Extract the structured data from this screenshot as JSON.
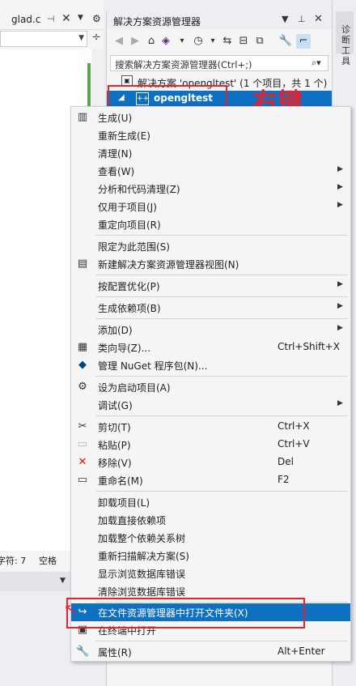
{
  "editor": {
    "tab_label": "glad.c",
    "tab_pin_icon": "pin-icon",
    "tab_close_icon": "close-icon",
    "status_chars": "字符: 7",
    "status_spaces": "空格"
  },
  "solution_explorer": {
    "title": "解决方案资源管理器",
    "search_placeholder": "搜索解决方案资源管理器(Ctrl+;)",
    "solution_label": "解决方案 'opengltest' (1 个项目，共 1 个)",
    "project_label": "opengltest"
  },
  "right_rail": {
    "label": "诊断工具"
  },
  "annotation": {
    "right_click_label": "右键",
    "color": "#e8222b"
  },
  "context_menu": {
    "items": [
      {
        "label": "生成(U)",
        "icon": "build-icon"
      },
      {
        "label": "重新生成(E)"
      },
      {
        "label": "清理(N)"
      },
      {
        "label": "查看(W)",
        "submenu": true
      },
      {
        "label": "分析和代码清理(Z)",
        "submenu": true
      },
      {
        "label": "仅用于项目(J)",
        "submenu": true
      },
      {
        "label": "重定向项目(R)"
      },
      {
        "label": "限定为此范围(S)"
      },
      {
        "label": "新建解决方案资源管理器视图(N)",
        "icon": "new-view-icon"
      },
      {
        "label": "按配置优化(P)",
        "submenu": true
      },
      {
        "label": "生成依赖项(B)",
        "submenu": true
      },
      {
        "label": "添加(D)",
        "submenu": true
      },
      {
        "label": "类向导(Z)...",
        "shortcut": "Ctrl+Shift+X",
        "icon": "class-wizard-icon"
      },
      {
        "label": "管理 NuGet 程序包(N)...",
        "icon": "nuget-icon"
      },
      {
        "label": "设为启动项目(A)",
        "icon": "gear-icon"
      },
      {
        "label": "调试(G)",
        "submenu": true
      },
      {
        "label": "剪切(T)",
        "shortcut": "Ctrl+X",
        "icon": "scissors-icon"
      },
      {
        "label": "粘贴(P)",
        "shortcut": "Ctrl+V",
        "icon": "paste-icon"
      },
      {
        "label": "移除(V)",
        "shortcut": "Del",
        "icon": "remove-icon"
      },
      {
        "label": "重命名(M)",
        "shortcut": "F2",
        "icon": "rename-icon"
      },
      {
        "label": "卸载项目(L)"
      },
      {
        "label": "加载直接依赖项"
      },
      {
        "label": "加载整个依赖关系树"
      },
      {
        "label": "重新扫描解决方案(S)"
      },
      {
        "label": "显示浏览数据库错误"
      },
      {
        "label": "清除浏览数据库错误"
      },
      {
        "label": "在文件资源管理器中打开文件夹(X)",
        "icon": "open-folder-icon",
        "highlighted": true
      },
      {
        "label": "在终端中打开",
        "icon": "terminal-icon"
      },
      {
        "label": "属性(R)",
        "shortcut": "Alt+Enter",
        "icon": "wrench-icon"
      }
    ]
  },
  "colors": {
    "highlight": "#0e70c0",
    "menu_bg": "#f5f5f5",
    "annotation_red": "#e8222b"
  }
}
